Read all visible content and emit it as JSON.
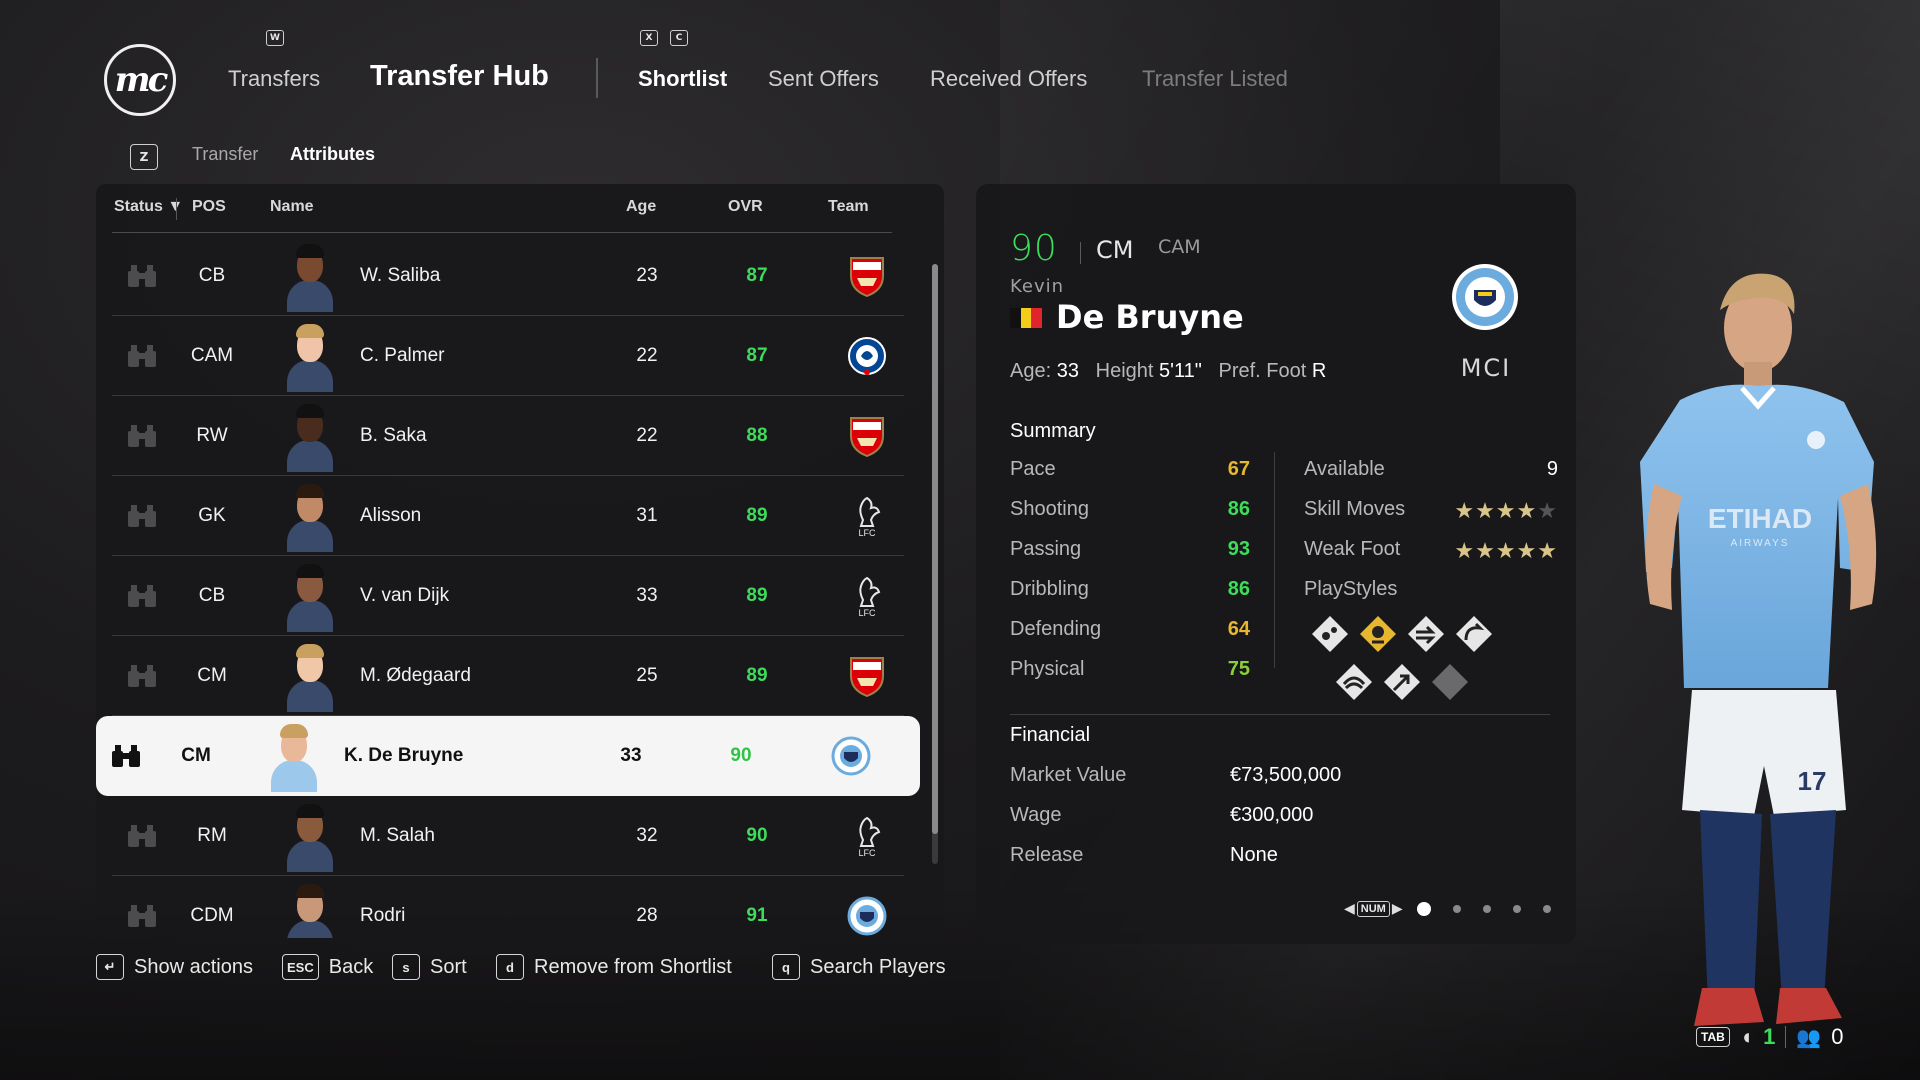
{
  "header": {
    "logo_text": "mc",
    "key_left": "W",
    "key_right_1": "X",
    "key_right_2": "C",
    "tabs": [
      {
        "label": "Transfers"
      },
      {
        "label": "Transfer Hub"
      },
      {
        "label": "Shortlist"
      },
      {
        "label": "Sent Offers"
      },
      {
        "label": "Received Offers"
      },
      {
        "label": "Transfer Listed"
      }
    ]
  },
  "subnav": {
    "key": "Z",
    "items": [
      {
        "label": "Transfer"
      },
      {
        "label": "Attributes"
      }
    ]
  },
  "table": {
    "columns": {
      "status": "Status",
      "sort_arrow": "▼",
      "pos": "POS",
      "name": "Name",
      "age": "Age",
      "ovr": "OVR",
      "team": "Team"
    },
    "rows": [
      {
        "pos": "CB",
        "name": "W. Saliba",
        "age": "23",
        "ovr": "87",
        "team": "arsenal"
      },
      {
        "pos": "CAM",
        "name": "C. Palmer",
        "age": "22",
        "ovr": "87",
        "team": "chelsea"
      },
      {
        "pos": "RW",
        "name": "B. Saka",
        "age": "22",
        "ovr": "88",
        "team": "arsenal"
      },
      {
        "pos": "GK",
        "name": "Alisson",
        "age": "31",
        "ovr": "89",
        "team": "liverpool"
      },
      {
        "pos": "CB",
        "name": "V. van Dijk",
        "age": "33",
        "ovr": "89",
        "team": "liverpool"
      },
      {
        "pos": "CM",
        "name": "M. Ødegaard",
        "age": "25",
        "ovr": "89",
        "team": "arsenal"
      },
      {
        "pos": "CM",
        "name": "K. De Bruyne",
        "age": "33",
        "ovr": "90",
        "team": "mancity",
        "selected": true
      },
      {
        "pos": "RM",
        "name": "M. Salah",
        "age": "32",
        "ovr": "90",
        "team": "liverpool"
      },
      {
        "pos": "CDM",
        "name": "Rodri",
        "age": "28",
        "ovr": "91",
        "team": "mancity"
      }
    ]
  },
  "actions": [
    {
      "key": "↵",
      "label": "Show actions"
    },
    {
      "key": "ESC",
      "label": "Back"
    },
    {
      "key": "s",
      "label": "Sort"
    },
    {
      "key": "d",
      "label": "Remove from Shortlist"
    },
    {
      "key": "q",
      "label": "Search Players"
    }
  ],
  "player": {
    "ovr": "90",
    "position": "CM",
    "alt_position": "CAM",
    "first_name": "Kevin",
    "last_name": "De Bruyne",
    "age_label": "Age:",
    "age": "33",
    "height_label": "Height",
    "height": "5'11\"",
    "foot_label": "Pref. Foot",
    "foot": "R",
    "club_abbr": "MCI",
    "kit_sponsor": "ETIHAD",
    "kit_sponsor_sub": "AIRWAYS",
    "kit_number": "17",
    "summary_title": "Summary",
    "stats": [
      {
        "label": "Pace",
        "value": "67",
        "color": "#e8b730"
      },
      {
        "label": "Shooting",
        "value": "86",
        "color": "#3ddc5a"
      },
      {
        "label": "Passing",
        "value": "93",
        "color": "#3ddc5a"
      },
      {
        "label": "Dribbling",
        "value": "86",
        "color": "#3ddc5a"
      },
      {
        "label": "Defending",
        "value": "64",
        "color": "#e8b730"
      },
      {
        "label": "Physical",
        "value": "75",
        "color": "#8ccf3a"
      }
    ],
    "available_label": "Available",
    "available": "9",
    "skill_moves_label": "Skill Moves",
    "skill_moves": 4,
    "weak_foot_label": "Weak Foot",
    "weak_foot": 5,
    "playstyles_label": "PlayStyles",
    "financial_title": "Financial",
    "market_value_label": "Market Value",
    "market_value": "€73,500,000",
    "wage_label": "Wage",
    "wage": "€300,000",
    "release_label": "Release",
    "release": "None",
    "pager_key": "NUM",
    "page_count": 5,
    "page_current": 1
  },
  "status": {
    "tab_key": "TAB",
    "count_a": "1",
    "count_b": "0"
  },
  "colors": {
    "accent_green": "#3ddc5a",
    "accent_yellow": "#e8b730",
    "star_gold": "#d9c48a",
    "panel": "#18181a"
  }
}
